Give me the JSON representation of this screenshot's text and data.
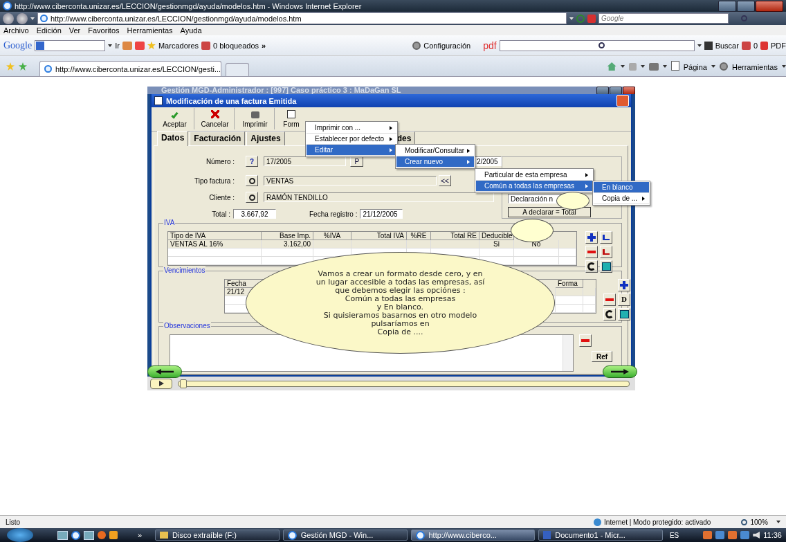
{
  "browser": {
    "title": "http://www.ciberconta.unizar.es/LECCION/gestionmgd/ayuda/modelos.htm - Windows Internet Explorer",
    "address": "http://www.ciberconta.unizar.es/LECCION/gestionmgd/ayuda/modelos.htm",
    "search_placeholder": "Google",
    "menu": [
      "Archivo",
      "Edición",
      "Ver",
      "Favoritos",
      "Herramientas",
      "Ayuda"
    ],
    "google_toolbar": {
      "logo": "Google",
      "go": "Ir",
      "bookmarks": "Marcadores",
      "blocked": "0 bloqueados",
      "more": "»",
      "settings": "Configuración",
      "pdf": "pdf",
      "search": "Buscar",
      "count": "0",
      "pdf_button": "PDF"
    },
    "tab": "http://www.ciberconta.unizar.es/LECCION/gesti...",
    "command_bar": [
      "Página",
      "Herramientas"
    ],
    "status": "Listo",
    "zone": "Internet | Modo protegido: activado",
    "zoom": "100%"
  },
  "app": {
    "window_title": "Gestión MGD-Administrador : [997] Caso práctico 3 : MaDaGan SL",
    "dialog_title": "Modificación de una factura Emitida",
    "toolbar": [
      {
        "label": "Aceptar",
        "kind": "check"
      },
      {
        "label": "Cancelar",
        "kind": "cross"
      },
      {
        "label": "Imprimir",
        "kind": "printer"
      },
      {
        "label": "Form",
        "kind": "formats"
      }
    ],
    "tabs": [
      {
        "label": "Datos",
        "selected": true
      },
      {
        "label": "Facturación",
        "selected": false
      },
      {
        "label": "Ajustes",
        "selected": false
      },
      {
        "label": "des",
        "selected": false
      }
    ],
    "numero": {
      "label": "Número :",
      "help": "?",
      "value": "17/2005",
      "button": "P",
      "other": "2/2005"
    },
    "tipo": {
      "label": "Tipo factura :",
      "value": "VENTAS",
      "button": "<<"
    },
    "cliente": {
      "label": "Cliente :",
      "value": "RAMÓN TENDILLO"
    },
    "total": {
      "label": "Total :",
      "value": "3.667,92"
    },
    "fecha": {
      "label": "Fecha registro :",
      "value": "21/12/2005"
    },
    "declaracion": {
      "value": "Declaración n",
      "button": "A declarar = Total"
    },
    "iva": {
      "legend": "IVA",
      "columns": [
        "Tipo de IVA",
        "Base Imp.",
        "%IVA",
        "Total IVA",
        "%RE",
        "Total RE",
        "Deducible"
      ],
      "rows": [
        [
          "VENTAS AL 16%",
          "3.162,00",
          "",
          "",
          "",
          "",
          "Si",
          "No"
        ]
      ]
    },
    "vencimientos": {
      "legend": "Vencimientos",
      "columns": [
        "Fecha",
        "Forma"
      ],
      "rows": [
        [
          "21/12"
        ]
      ]
    },
    "observaciones": {
      "legend": "Observaciones",
      "button": "Ref"
    },
    "side_d": "D",
    "menus": [
      {
        "items": [
          {
            "label": "Imprimir con ...",
            "selected": false,
            "submenu": true
          },
          {
            "label": "Establecer por defecto",
            "selected": false,
            "submenu": true
          },
          {
            "label": "Editar",
            "selected": true,
            "submenu": true
          }
        ]
      },
      {
        "items": [
          {
            "label": "Modificar/Consultar",
            "selected": false,
            "submenu": true
          },
          {
            "label": "Crear nuevo",
            "selected": true,
            "submenu": true
          }
        ]
      },
      {
        "items": [
          {
            "label": "Particular de esta empresa",
            "selected": false,
            "submenu": true
          },
          {
            "label": "Común a todas las empresas",
            "selected": true,
            "submenu": true
          }
        ]
      },
      {
        "items": [
          {
            "label": "En blanco",
            "selected": true,
            "submenu": false
          },
          {
            "label": "Copia de ...",
            "selected": false,
            "submenu": true
          }
        ]
      }
    ],
    "callout": [
      "Vamos a crear un formato desde cero, y en",
      "un lugar accesible a todas las empresas, así",
      "que debemos elegir las opciónes :",
      "Común a todas las empresas",
      "y En blanco.",
      "Si quisieramos basarnos en otro modelo",
      "pulsaríamos en",
      "Copia de ...."
    ],
    "player": {
      "level": 0
    }
  },
  "taskbar": {
    "more": "»",
    "items": [
      {
        "label": "Disco extraíble (F:)",
        "selected": false
      },
      {
        "label": "Gestión MGD - Win...",
        "selected": false
      },
      {
        "label": "http://www.ciberco...",
        "selected": true
      },
      {
        "label": "Documento1 - Micr...",
        "selected": false
      }
    ],
    "language": "ES",
    "clock": "11:36"
  }
}
